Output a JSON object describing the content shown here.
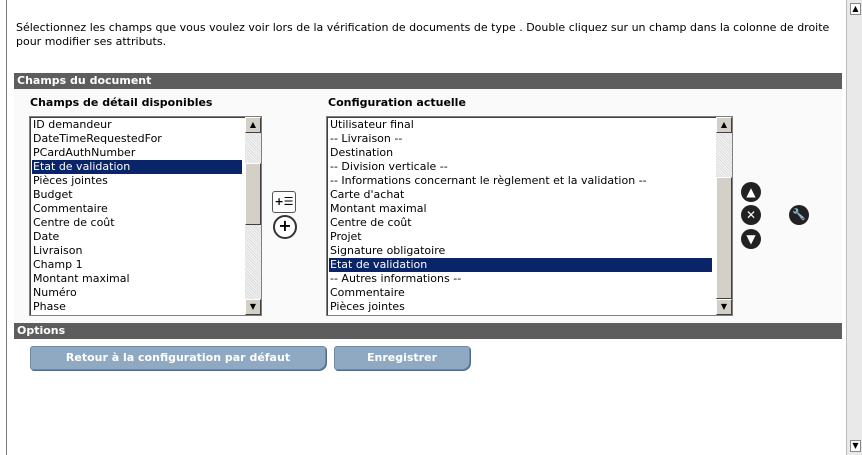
{
  "intro_text": "Sélectionnez les champs que vous voulez voir lors de la vérification de documents de type . Double cliquez sur un champ dans la colonne de droite pour modifier ses attributs.",
  "section_fields_title": "Champs du document",
  "available": {
    "heading": "Champs de détail disponibles",
    "items": [
      "ID demandeur",
      "DateTimeRequestedFor",
      "PCardAuthNumber",
      "Etat de validation",
      "Pièces jointes",
      "Budget",
      "Commentaire",
      "Centre de coût",
      "Date",
      "Livraison",
      "Champ 1",
      "Montant maximal",
      "Numéro",
      "Phase"
    ],
    "selected_index": 3
  },
  "current": {
    "heading": "Configuration actuelle",
    "items": [
      "Utilisateur final",
      "-- Livraison --",
      "Destination",
      "-- Division verticale --",
      "-- Informations concernant le règlement et la validation --",
      "Carte d'achat",
      "Montant maximal",
      "Centre de coût",
      "Projet",
      "Signature obligatoire",
      "Etat de validation",
      "-- Autres informations --",
      "Commentaire",
      "Pièces jointes"
    ],
    "selected_index": 10
  },
  "icons": {
    "add_list": "add-to-list-icon",
    "add": "plus-circle-icon",
    "move_up": "arrow-up-icon",
    "remove": "x-circle-icon",
    "move_down": "arrow-down-icon",
    "edit": "wrench-icon"
  },
  "section_options_title": "Options",
  "buttons": {
    "reset_label": "Retour à la configuration par défaut",
    "save_label": "Enregistrer"
  }
}
